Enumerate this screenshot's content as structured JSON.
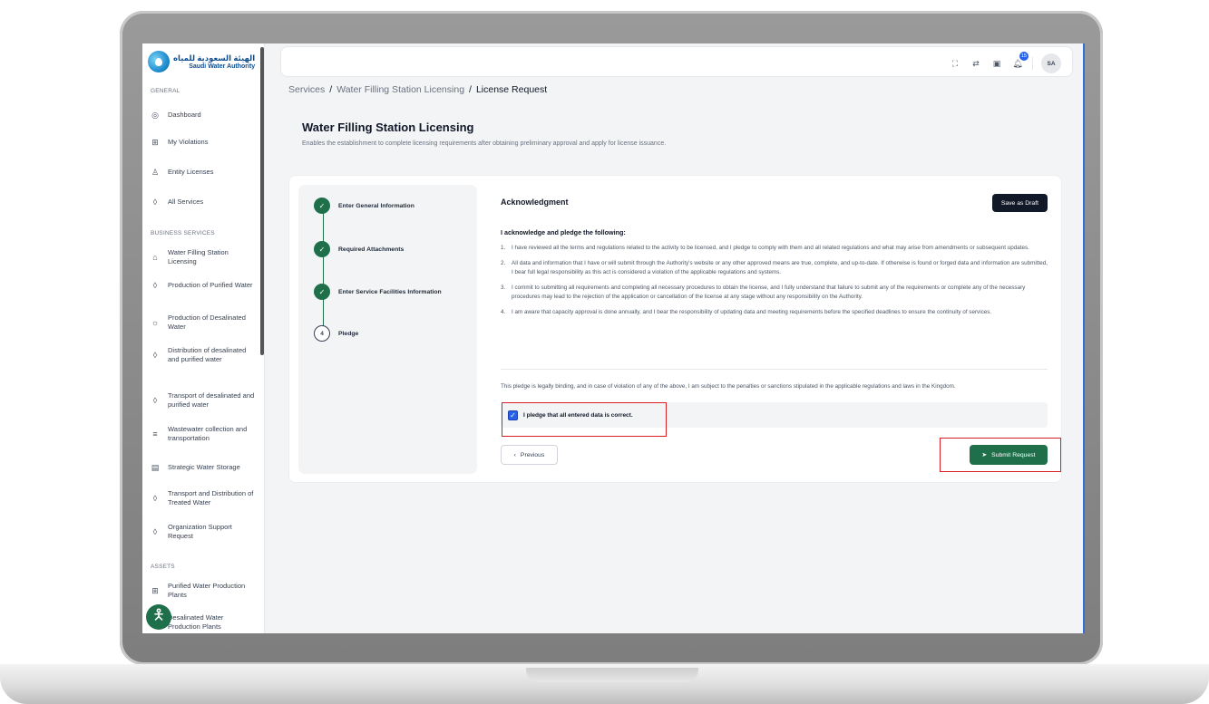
{
  "logo": {
    "arabic": "الهيئة السعودية للمياه",
    "english": "Saudi Water Authority"
  },
  "sidebar": {
    "general_title": "GENERAL",
    "general": [
      {
        "label": "Dashboard",
        "icon": "gauge-icon"
      },
      {
        "label": "My Violations",
        "icon": "grid-icon"
      },
      {
        "label": "Entity Licenses",
        "icon": "user-icon"
      },
      {
        "label": "All Services",
        "icon": "drop-icon"
      }
    ],
    "business_title": "BUSINESS SERVICES",
    "business": [
      {
        "label": "Water Filling Station Licensing",
        "icon": "station-icon"
      },
      {
        "label": "Production of Purified Water",
        "icon": "drop-icon"
      },
      {
        "label": "Production of Desalinated Water",
        "icon": "sun-icon"
      },
      {
        "label": "Distribution of desalinated and purified water",
        "icon": "drop-icon"
      },
      {
        "label": "Transport of desalinated and purified water",
        "icon": "drop-icon"
      },
      {
        "label": "Wastewater collection and transportation",
        "icon": "pipes-icon"
      },
      {
        "label": "Strategic Water Storage",
        "icon": "storage-icon"
      },
      {
        "label": "Transport and Distribution of Treated Water",
        "icon": "drop-icon"
      },
      {
        "label": "Organization Support Request",
        "icon": "drop-icon"
      }
    ],
    "assets_title": "ASSETS",
    "assets": [
      {
        "label": "Purified Water Production Plants",
        "icon": "table-icon"
      },
      {
        "label": "Desalinated Water Production Plants",
        "icon": "table-icon"
      }
    ]
  },
  "topbar": {
    "notification_count": "15",
    "avatar_initials": "SA"
  },
  "breadcrumb": {
    "services": "Services",
    "licensing": "Water Filling Station Licensing",
    "current": "License Request",
    "separator": "/"
  },
  "page": {
    "title": "Water Filling Station Licensing",
    "subtitle": "Enables the establishment to complete licensing requirements after obtaining preliminary approval and apply for license issuance."
  },
  "steps": [
    {
      "label": "Enter General Information",
      "status": "done"
    },
    {
      "label": "Required Attachments",
      "status": "done"
    },
    {
      "label": "Enter Service Facilities Information",
      "status": "done"
    },
    {
      "label": "Pledge",
      "status": "current",
      "number": "4"
    }
  ],
  "acknowledgment": {
    "heading": "Acknowledgment",
    "save_draft": "Save as Draft",
    "pledge_title": "I acknowledge and pledge the following:",
    "terms": [
      {
        "num": "1.",
        "text": "I have reviewed all the terms and regulations related to the activity to be licensed, and I pledge to comply with them and all related regulations and what may arise from amendments or subsequent updates."
      },
      {
        "num": "2.",
        "text": "All data and information that I have or will submit through the Authority's website or any other approved means are true, complete, and up-to-date. If otherwise is found or forged data and information are submitted, I bear full legal responsibility as this act is considered a violation of the applicable regulations and systems."
      },
      {
        "num": "3.",
        "text": "I commit to submitting all requirements and completing all necessary procedures to obtain the license, and I fully understand that failure to submit any of the requirements or complete any of the necessary procedures may lead to the rejection of the application or cancellation of the license at any stage without any responsibility on the Authority."
      },
      {
        "num": "4.",
        "text": "I am aware that capacity approval is done annually, and I bear the responsibility of updating data and meeting requirements before the specified deadlines to ensure the continuity of services."
      }
    ],
    "binding_text": "This pledge is legally binding, and in case of violation of any of the above, I am subject to the penalties or sanctions stipulated in the applicable regulations and laws in the Kingdom.",
    "checkbox_label": "I pledge that all entered data is correct.",
    "checkbox_checked": true,
    "previous": "Previous",
    "submit": "Submit Request"
  },
  "colors": {
    "primary_green": "#1f6f4b",
    "highlight_red": "#d91f26",
    "dark_button": "#111827",
    "checkbox_blue": "#2563eb"
  }
}
